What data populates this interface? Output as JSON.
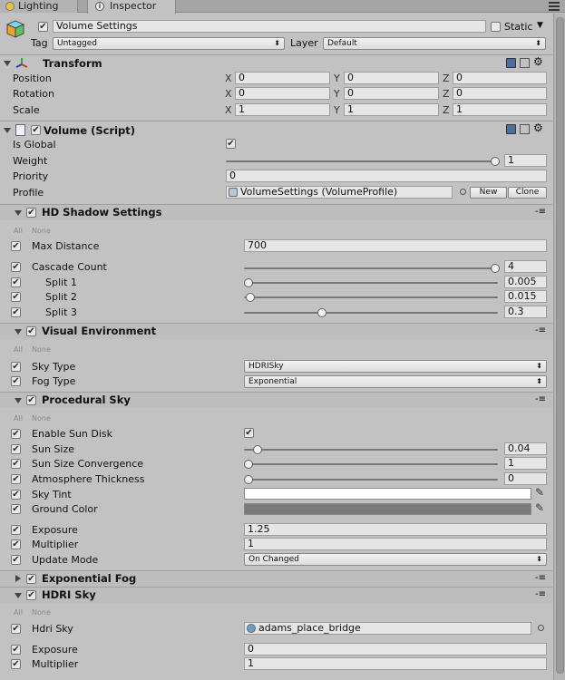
{
  "tabs": {
    "lighting": "Lighting",
    "inspector": "Inspector"
  },
  "object": {
    "name": "Volume Settings",
    "static_label": "Static",
    "tag_label": "Tag",
    "tag_value": "Untagged",
    "layer_label": "Layer",
    "layer_value": "Default"
  },
  "transform": {
    "title": "Transform",
    "position_label": "Position",
    "rotation_label": "Rotation",
    "scale_label": "Scale",
    "axis": {
      "x": "X",
      "y": "Y",
      "z": "Z"
    },
    "position": {
      "x": "0",
      "y": "0",
      "z": "0"
    },
    "rotation": {
      "x": "0",
      "y": "0",
      "z": "0"
    },
    "scale": {
      "x": "1",
      "y": "1",
      "z": "1"
    }
  },
  "volume": {
    "title": "Volume (Script)",
    "is_global_label": "Is Global",
    "weight_label": "Weight",
    "weight_value": "1",
    "weight_fraction": 1.0,
    "priority_label": "Priority",
    "priority_value": "0",
    "profile_label": "Profile",
    "profile_value": "VolumeSettings (VolumeProfile)",
    "new_button": "New",
    "clone_button": "Clone"
  },
  "all_label": "All",
  "none_label": "None",
  "hd_shadow": {
    "title": "HD Shadow Settings",
    "max_distance_label": "Max Distance",
    "max_distance_value": "700",
    "cascade_count_label": "Cascade Count",
    "cascade_count_value": "4",
    "split1_label": "Split 1",
    "split1_value": "0.005",
    "split2_label": "Split 2",
    "split2_value": "0.015",
    "split3_label": "Split 3",
    "split3_value": "0.3"
  },
  "visual_env": {
    "title": "Visual Environment",
    "sky_type_label": "Sky Type",
    "sky_type_value": "HDRISky",
    "fog_type_label": "Fog Type",
    "fog_type_value": "Exponential"
  },
  "procedural_sky": {
    "title": "Procedural Sky",
    "enable_sun_disk_label": "Enable Sun Disk",
    "sun_size_label": "Sun Size",
    "sun_size_value": "0.04",
    "sun_size_convergence_label": "Sun Size Convergence",
    "sun_size_convergence_value": "1",
    "atmosphere_thickness_label": "Atmosphere Thickness",
    "atmosphere_thickness_value": "0",
    "sky_tint_label": "Sky Tint",
    "sky_tint_color": "#ffffff",
    "ground_color_label": "Ground Color",
    "ground_color_color": "#7a7a7a",
    "exposure_label": "Exposure",
    "exposure_value": "1.25",
    "multiplier_label": "Multiplier",
    "multiplier_value": "1",
    "update_mode_label": "Update Mode",
    "update_mode_value": "On Changed"
  },
  "exp_fog": {
    "title": "Exponential Fog"
  },
  "hdri_sky": {
    "title": "HDRI Sky",
    "hdri_sky_label": "Hdri Sky",
    "hdri_sky_value": "adams_place_bridge",
    "exposure_label": "Exposure",
    "exposure_value": "0",
    "multiplier_label": "Multiplier",
    "multiplier_value": "1"
  }
}
